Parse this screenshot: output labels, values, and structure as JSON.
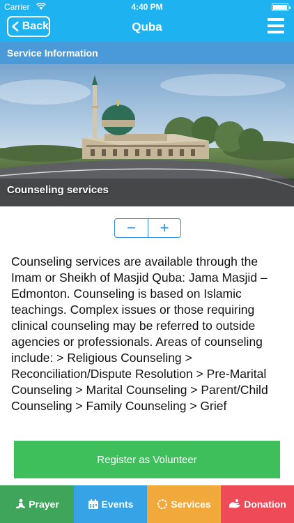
{
  "status_bar": {
    "carrier": "Carrier",
    "time": "4:40 PM"
  },
  "nav": {
    "back_label": "Back",
    "title": "Quba"
  },
  "section": {
    "title": "Service Information"
  },
  "hero": {
    "caption": "Counseling services"
  },
  "stepper": {
    "minus": "−",
    "plus": "+"
  },
  "content": {
    "description": "Counseling services are available through the Imam or Sheikh of Masjid Quba: Jama Masjid – Edmonton. Counseling is based on Islamic teachings. Complex issues or those requiring clinical counseling may be referred to outside agencies or professionals. Areas of counseling include: > Religious Counseling > Reconciliation/Dispute Resolution > Pre-Marital Counseling > Marital Counseling > Parent/Child Counseling > Family Counseling > Grief"
  },
  "actions": {
    "volunteer_label": "Register as Volunteer"
  },
  "tabs": [
    {
      "label": "Prayer",
      "icon": "prayer-icon",
      "color": "#3fa55a"
    },
    {
      "label": "Events",
      "icon": "calendar-icon",
      "color": "#36a3e6"
    },
    {
      "label": "Services",
      "icon": "services-icon",
      "color": "#f2a93b"
    },
    {
      "label": "Donation",
      "icon": "donation-icon",
      "color": "#ef4a58"
    }
  ],
  "colors": {
    "header": "#1fb2f0",
    "section_header": "#4a99d8",
    "accent": "#2a8ce8",
    "volunteer_button": "#3fbf5c"
  }
}
